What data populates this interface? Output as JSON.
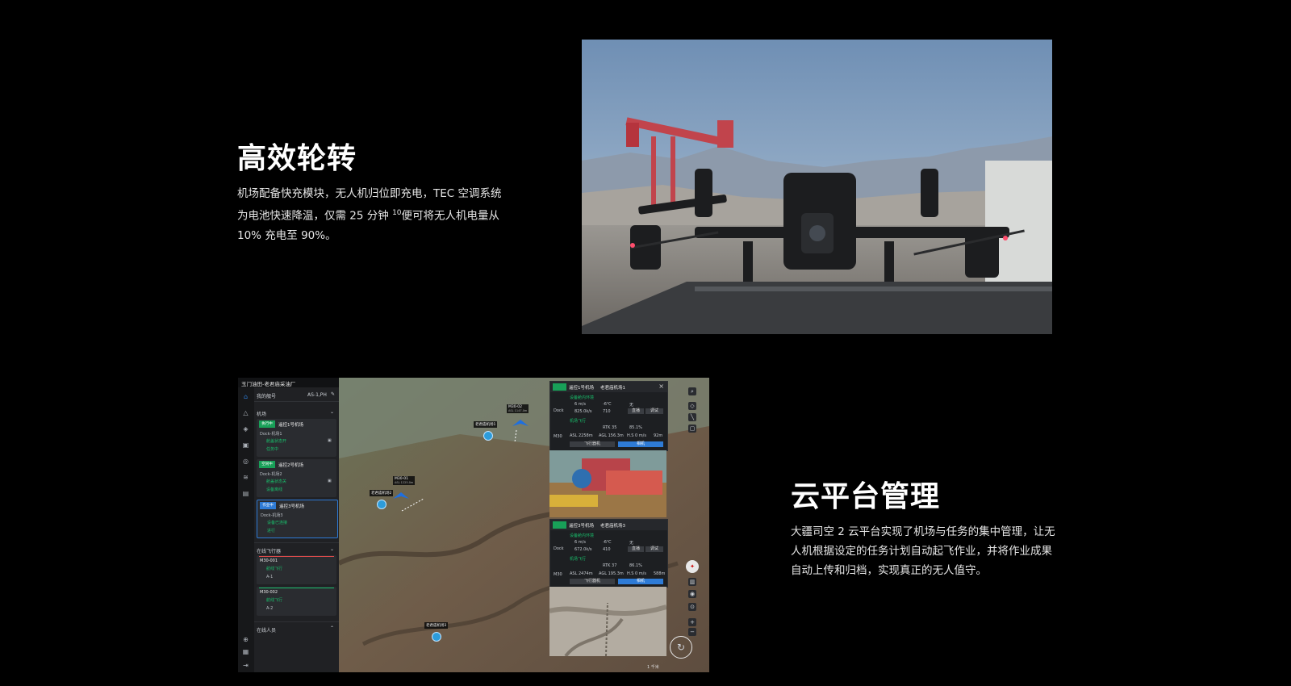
{
  "section1": {
    "title": "高效轮转",
    "line1": "机场配备快充模块，无人机归位即充电，TEC 空调系统",
    "line2_pre": "为电池快速降温，仅需 25 分钟 ",
    "line2_sup": "10",
    "line2_post": "便可将无人机电量从",
    "line3": "10% 充电至 90%。"
  },
  "section2": {
    "title": "云平台管理",
    "line1": "大疆司空 2 云平台实现了机场与任务的集中管理，让无",
    "line2": "人机根据设定的任务计划自动起飞作业，并将作业成果",
    "line3": "自动上传和归档，实现真正的无人值守。"
  },
  "screenshot": {
    "project_title": "玉门油田-老君庙采油厂",
    "my_team": "我的舰号",
    "team_id": "AS-1,PH",
    "dock_section": "机场",
    "docks": [
      {
        "badge": "执行中",
        "name": "遥控1号机场",
        "aircraft": "Dock-机场1",
        "status": "舱盖状态开",
        "extra": "任务中"
      },
      {
        "badge": "空闲中",
        "name": "遥控2号机场",
        "aircraft": "Dock-机场2",
        "status": "舱盖状态关",
        "extra": "设备离线"
      },
      {
        "badge": "作业中",
        "name": "遥控3号机场",
        "aircraft": "Dock-机场3",
        "status": "设备已连接",
        "extra": "进行"
      }
    ],
    "online_aircraft_section": "在线飞行器",
    "aircraft": [
      {
        "name": "M30-001",
        "status": "航线飞行",
        "pilot": "A-1"
      },
      {
        "name": "M30-002",
        "status": "航线飞行",
        "pilot": "A-2"
      }
    ],
    "online_people": "在线人员",
    "map_labels": {
      "m1": "M30-02",
      "m1_sub": "ASL 1147.0m",
      "m2": "M30-01",
      "m2_sub": "ASL 1225.0m",
      "d1": "老君庙机场1",
      "d2": "老君庙机场2",
      "d3": "老君庙机场3"
    },
    "tele1": {
      "dock": "遥控1号机场",
      "site": "老君庙机场1",
      "dock_label": "Dock",
      "aircraft_label": "M30",
      "section_a": "设备舱内环境",
      "wind": "6 m/s",
      "temp": "-6℃",
      "rain": "无",
      "net": "825.0k/s",
      "bar": "710",
      "section_b": "机场飞行",
      "rtk": "RTK 35",
      "battery": "85.1%",
      "asl": "ASL 2258m",
      "agl": "AGL 156.3m",
      "hs": "H.S 0 m/s",
      "dist": "92m",
      "btn_a": "飞行器机",
      "btn_b": "相机"
    },
    "tele2": {
      "dock": "遥控3号机场",
      "site": "老君庙机场3",
      "dock_label": "Dock",
      "aircraft_label": "M30",
      "section_a": "设备舱内环境",
      "wind": "6 m/s",
      "temp": "-6℃",
      "rain": "无",
      "net": "672.0k/s",
      "bar": "410",
      "section_b": "机场飞行",
      "rtk": "RTK 37",
      "battery": "86.1%",
      "asl": "ASL 2474m",
      "agl": "AGL 195.3m",
      "hs": "H.S 0 m/s",
      "dist": "588m",
      "btn_a": "飞行器机",
      "btn_b": "相机"
    },
    "scale": "1 千米"
  }
}
